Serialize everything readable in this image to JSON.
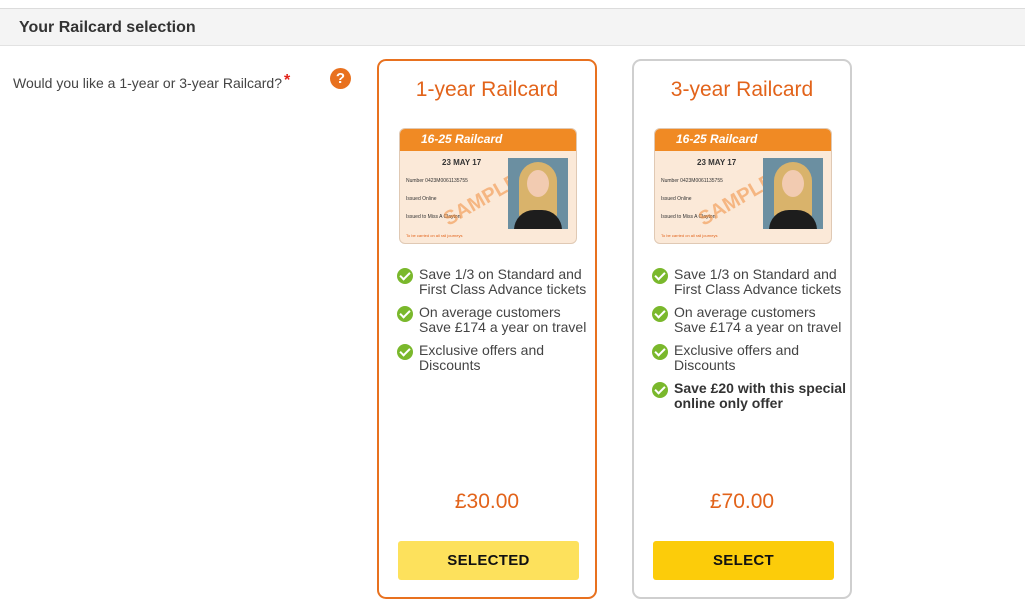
{
  "section": {
    "title": "Your Railcard selection"
  },
  "question": {
    "label": "Would you like a 1-year or 3-year Railcard?",
    "required_mark": "*",
    "help_icon": "?"
  },
  "cards": [
    {
      "title": "1-year Railcard",
      "features": [
        "Save 1/3 on Standard and First Class Advance tickets",
        "On average customers Save £174 a year on travel",
        "Exclusive offers and Discounts"
      ],
      "price": "£30.00",
      "button_label": "SELECTED",
      "state": "selected"
    },
    {
      "title": "3-year Railcard",
      "features": [
        "Save 1/3 on Standard and First Class Advance tickets",
        "On average customers Save £174 a year on travel",
        "Exclusive offers and Discounts",
        "Save £20 with this special online only offer"
      ],
      "price": "£70.00",
      "button_label": "SELECT",
      "state": "unselected"
    }
  ],
  "railcard_image": {
    "name": "16-25 Railcard",
    "valid_until": "23 MAY 17",
    "number": "Number 0423M0061135755",
    "type": "Issued Online",
    "holder": "Issued to Miss A Clayton",
    "footer": "To be carried on all rail journeys",
    "watermark": "SAMPLE"
  },
  "colors": {
    "accent": "#e8711f",
    "price": "#e2631a",
    "check": "#7ab82c",
    "button_select": "#fccc0a",
    "button_selected": "#fde15c"
  }
}
